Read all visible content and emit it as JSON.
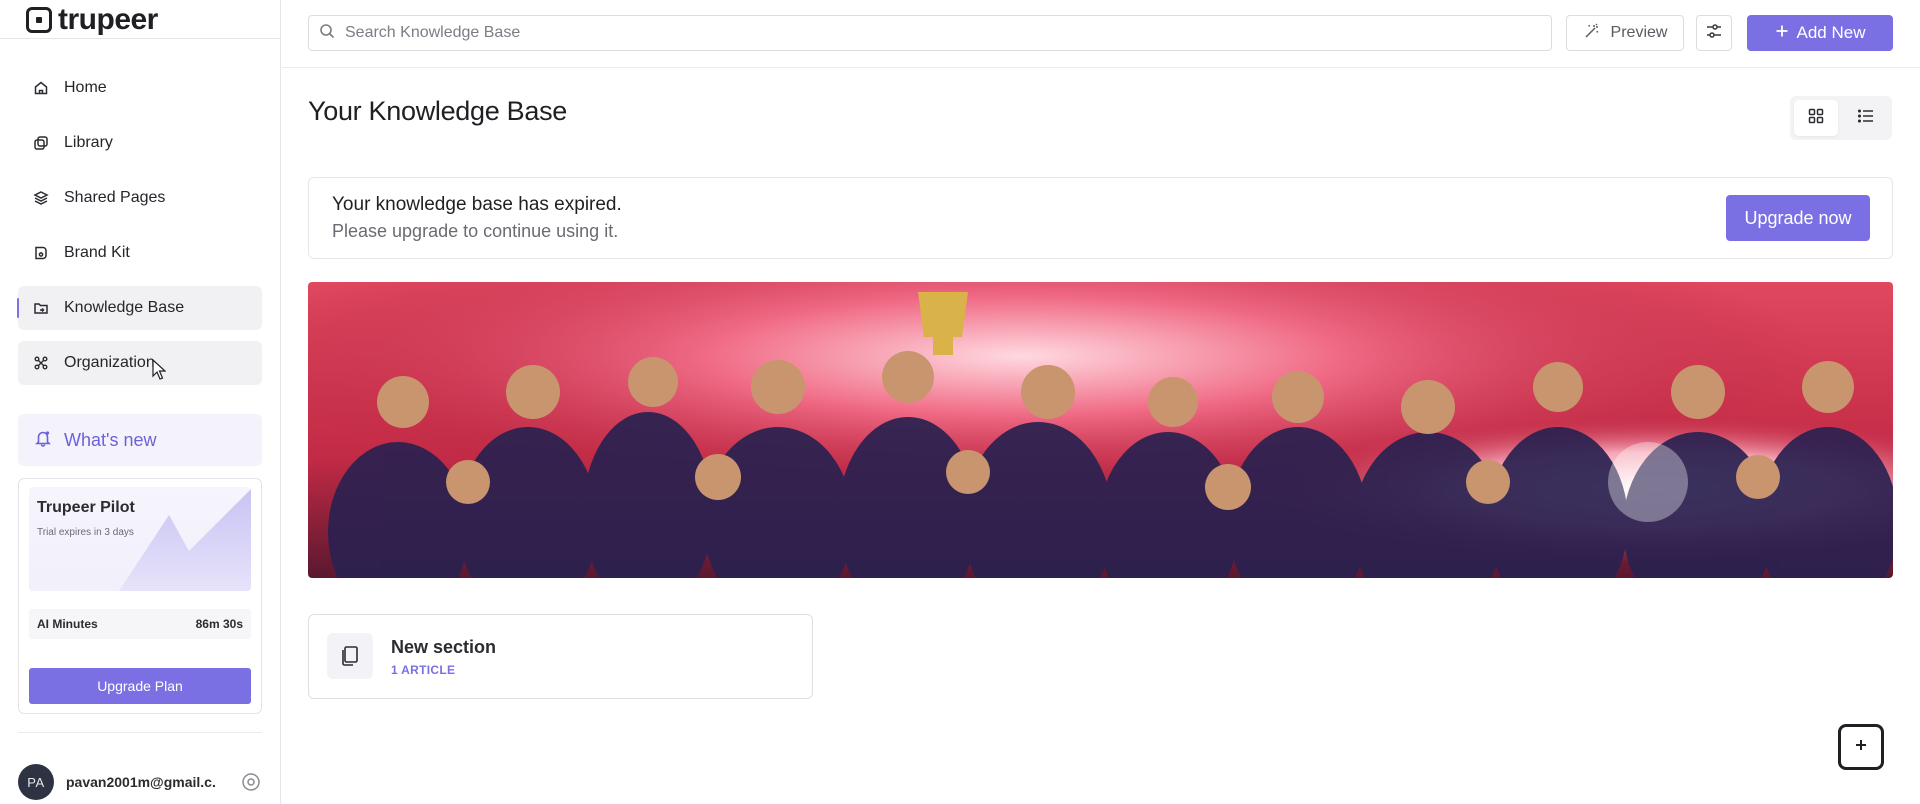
{
  "app": {
    "logo_text": "trupeer"
  },
  "sidebar": {
    "items": [
      {
        "label": "Home",
        "icon": "home-icon"
      },
      {
        "label": "Library",
        "icon": "library-icon"
      },
      {
        "label": "Shared Pages",
        "icon": "layers-icon"
      },
      {
        "label": "Brand Kit",
        "icon": "brand-kit-icon"
      },
      {
        "label": "Knowledge Base",
        "icon": "folder-link-icon",
        "active": true
      },
      {
        "label": "Organization",
        "icon": "organization-icon"
      }
    ],
    "whats_new": "What's new",
    "pilot": {
      "title": "Trupeer Pilot",
      "subtitle": "Trial expires in 3 days",
      "ai_label": "AI Minutes",
      "ai_value": "86m 30s",
      "upgrade_label": "Upgrade Plan"
    },
    "user": {
      "initials": "PA",
      "email": "pavan2001m@gmail.c..."
    }
  },
  "topbar": {
    "search_placeholder": "Search Knowledge Base",
    "preview_label": "Preview",
    "add_label": "Add New"
  },
  "main": {
    "title": "Your Knowledge Base",
    "banner": {
      "title": "Your knowledge base has expired.",
      "subtitle": "Please upgrade to continue using it.",
      "cta": "Upgrade now"
    },
    "section": {
      "title": "New section",
      "count": "1 ARTICLE"
    }
  },
  "colors": {
    "accent": "#7a70e4",
    "border": "#e6e6ea",
    "text": "#1f2024"
  }
}
